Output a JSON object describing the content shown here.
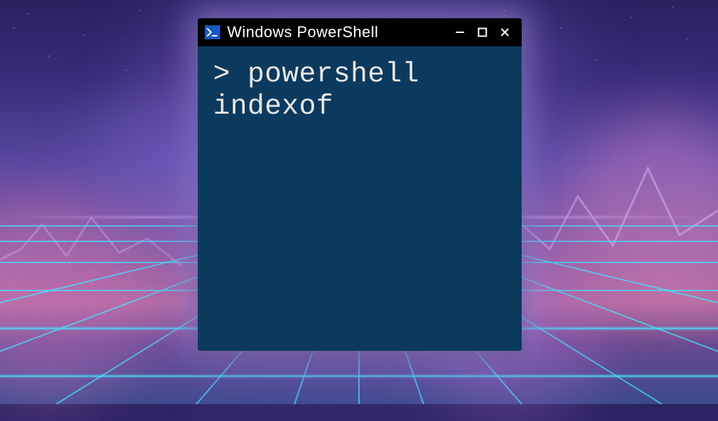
{
  "window": {
    "title": "Windows PowerShell",
    "ps_icon_glyph": ">_",
    "controls": {
      "minimize": "minimize",
      "maximize": "maximize",
      "close": "close"
    }
  },
  "terminal": {
    "prompt": "> ",
    "command": "powershell indexof"
  },
  "colors": {
    "terminal_bg": "#0c3a5e",
    "text": "#e8e8e8",
    "titlebar_bg": "#000000",
    "ps_icon_bg": "#1a56c8"
  }
}
